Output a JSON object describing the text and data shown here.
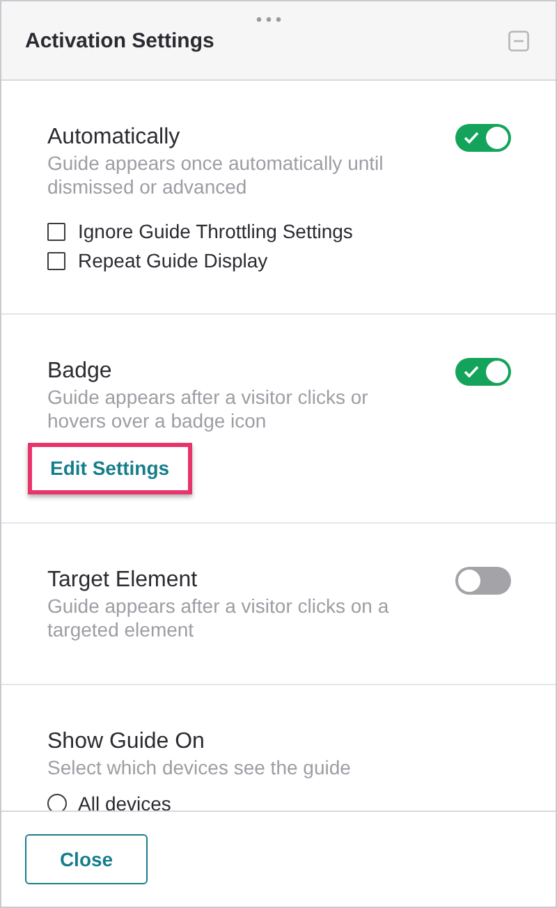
{
  "panel": {
    "title": "Activation Settings"
  },
  "sections": [
    {
      "kind": "toggle",
      "title": "Automatically",
      "description": "Guide appears once automatically until dismissed or advanced",
      "on": true,
      "options": [
        {
          "label": "Ignore Guide Throttling Settings",
          "checked": false
        },
        {
          "label": "Repeat Guide Display",
          "checked": false
        }
      ]
    },
    {
      "kind": "toggle",
      "title": "Badge",
      "description": "Guide appears after a visitor clicks or hovers over a badge icon",
      "on": true,
      "link": {
        "label": "Edit Settings",
        "highlighted": true
      }
    },
    {
      "kind": "toggle",
      "title": "Target Element",
      "description": "Guide appears after a visitor clicks on a targeted element",
      "on": false
    },
    {
      "kind": "radio",
      "title": "Show Guide On",
      "description": "Select which devices see the guide",
      "choices": [
        {
          "label": "All devices",
          "selected": false
        }
      ]
    }
  ],
  "footer": {
    "button": "Close"
  }
}
